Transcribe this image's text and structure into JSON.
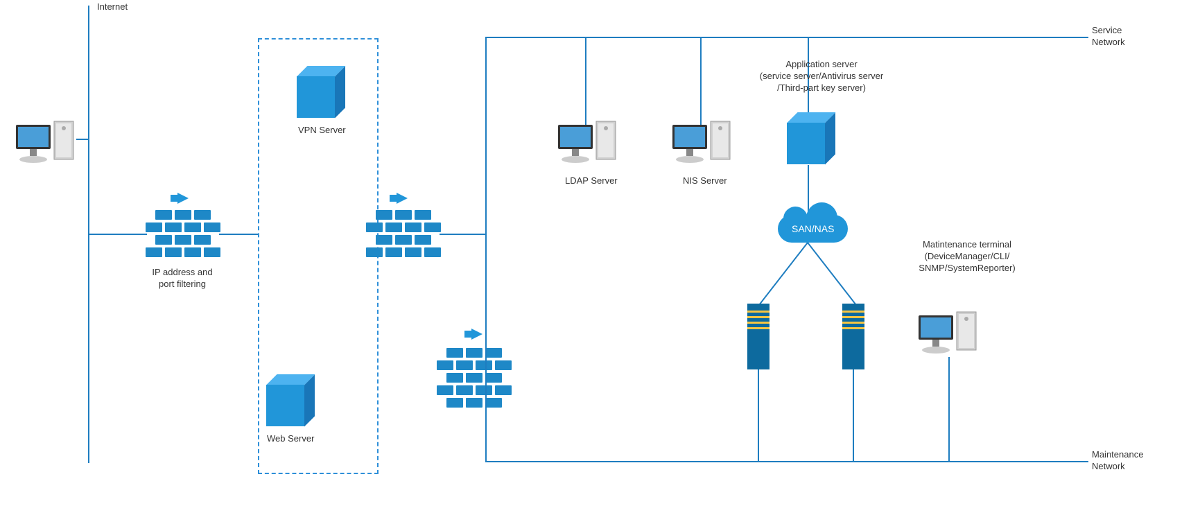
{
  "internet_label": "Internet",
  "vpn_server_label": "VPN Server",
  "web_server_label": "Web Server",
  "firewall1_label": "IP address and\nport filtering",
  "ldap_server_label": "LDAP Server",
  "nis_server_label": "NIS Server",
  "app_server_label": "Application server\n(service server/Antivirus server\n/Third-part key server)",
  "san_nas_label": "SAN/NAS",
  "maintenance_terminal_label": "Matintenance terminal\n(DeviceManager/CLI/\nSNMP/SystemReporter)",
  "service_network_label": "Service\nNetwork",
  "maintenance_network_label": "Maintenance\nNetwork"
}
